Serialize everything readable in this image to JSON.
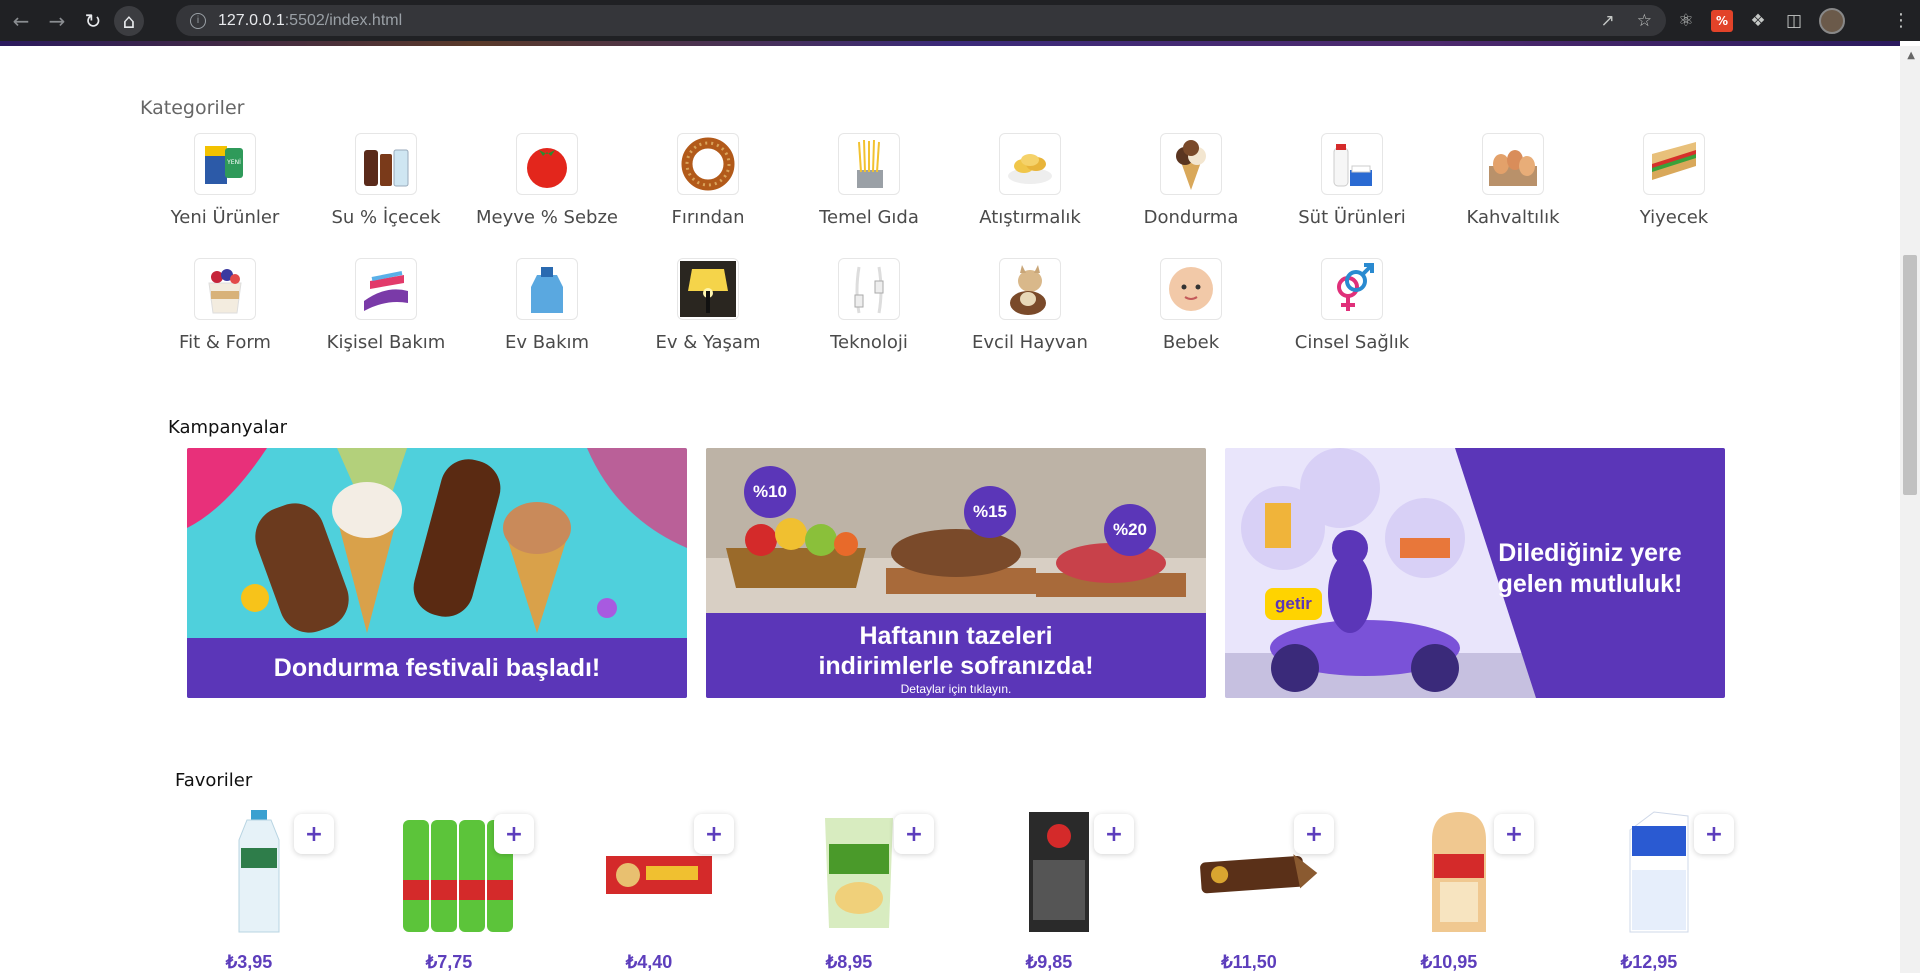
{
  "browser": {
    "url_host": "127.0.0.1",
    "url_rest": ":5502/index.html",
    "back_icon": "arrow-left",
    "forward_icon": "arrow-right",
    "reload_icon": "reload",
    "home_icon": "home"
  },
  "categories": {
    "title": "Kategoriler",
    "items": [
      {
        "label": "Yeni Ürünler",
        "icon": "new-products-icon"
      },
      {
        "label": "Su % İçecek",
        "icon": "drinks-icon"
      },
      {
        "label": "Meyve % Sebze",
        "icon": "tomato-icon"
      },
      {
        "label": "Fırından",
        "icon": "simit-icon"
      },
      {
        "label": "Temel Gıda",
        "icon": "pasta-icon"
      },
      {
        "label": "Atıştırmalık",
        "icon": "chips-icon"
      },
      {
        "label": "Dondurma",
        "icon": "ice-cream-icon"
      },
      {
        "label": "Süt Ürünleri",
        "icon": "milk-icon"
      },
      {
        "label": "Kahvaltılık",
        "icon": "eggs-icon"
      },
      {
        "label": "Yiyecek",
        "icon": "sandwich-icon"
      },
      {
        "label": "Fit & Form",
        "icon": "yogurt-icon"
      },
      {
        "label": "Kişisel Bakım",
        "icon": "toothpaste-icon"
      },
      {
        "label": "Ev Bakım",
        "icon": "detergent-icon"
      },
      {
        "label": "Ev & Yaşam",
        "icon": "lamp-icon"
      },
      {
        "label": "Teknoloji",
        "icon": "cable-icon"
      },
      {
        "label": "Evcil Hayvan",
        "icon": "pet-icon"
      },
      {
        "label": "Bebek",
        "icon": "baby-icon"
      },
      {
        "label": "Cinsel Sağlık",
        "icon": "gender-icon"
      }
    ]
  },
  "campaigns": {
    "title": "Kampanyalar",
    "banner1": {
      "caption": "Dondurma festivali başladı!"
    },
    "banner2": {
      "badges": [
        "%10",
        "%15",
        "%20"
      ],
      "line1": "Haftanın tazeleri",
      "line2": "indirimlerle sofranızda!",
      "sub": "Detaylar için tıklayın."
    },
    "banner3": {
      "line1": "Dilediğiniz yere",
      "line2": "gelen mutluluk!",
      "brand": "getir"
    }
  },
  "favorites": {
    "title": "Favoriler",
    "add_label": "+",
    "items": [
      {
        "price": "₺3,95",
        "product": "water"
      },
      {
        "price": "₺7,75",
        "product": "mineral-water"
      },
      {
        "price": "₺4,40",
        "product": "biscuit"
      },
      {
        "price": "₺8,95",
        "product": "chips"
      },
      {
        "price": "₺9,85",
        "product": "sunflower-seeds"
      },
      {
        "price": "₺11,50",
        "product": "ice-cream"
      },
      {
        "price": "₺10,95",
        "product": "toast-bread"
      },
      {
        "price": "₺12,95",
        "product": "milk"
      }
    ]
  },
  "colors": {
    "brand_purple": "#5d3ebc",
    "chrome_bg": "#202124"
  }
}
